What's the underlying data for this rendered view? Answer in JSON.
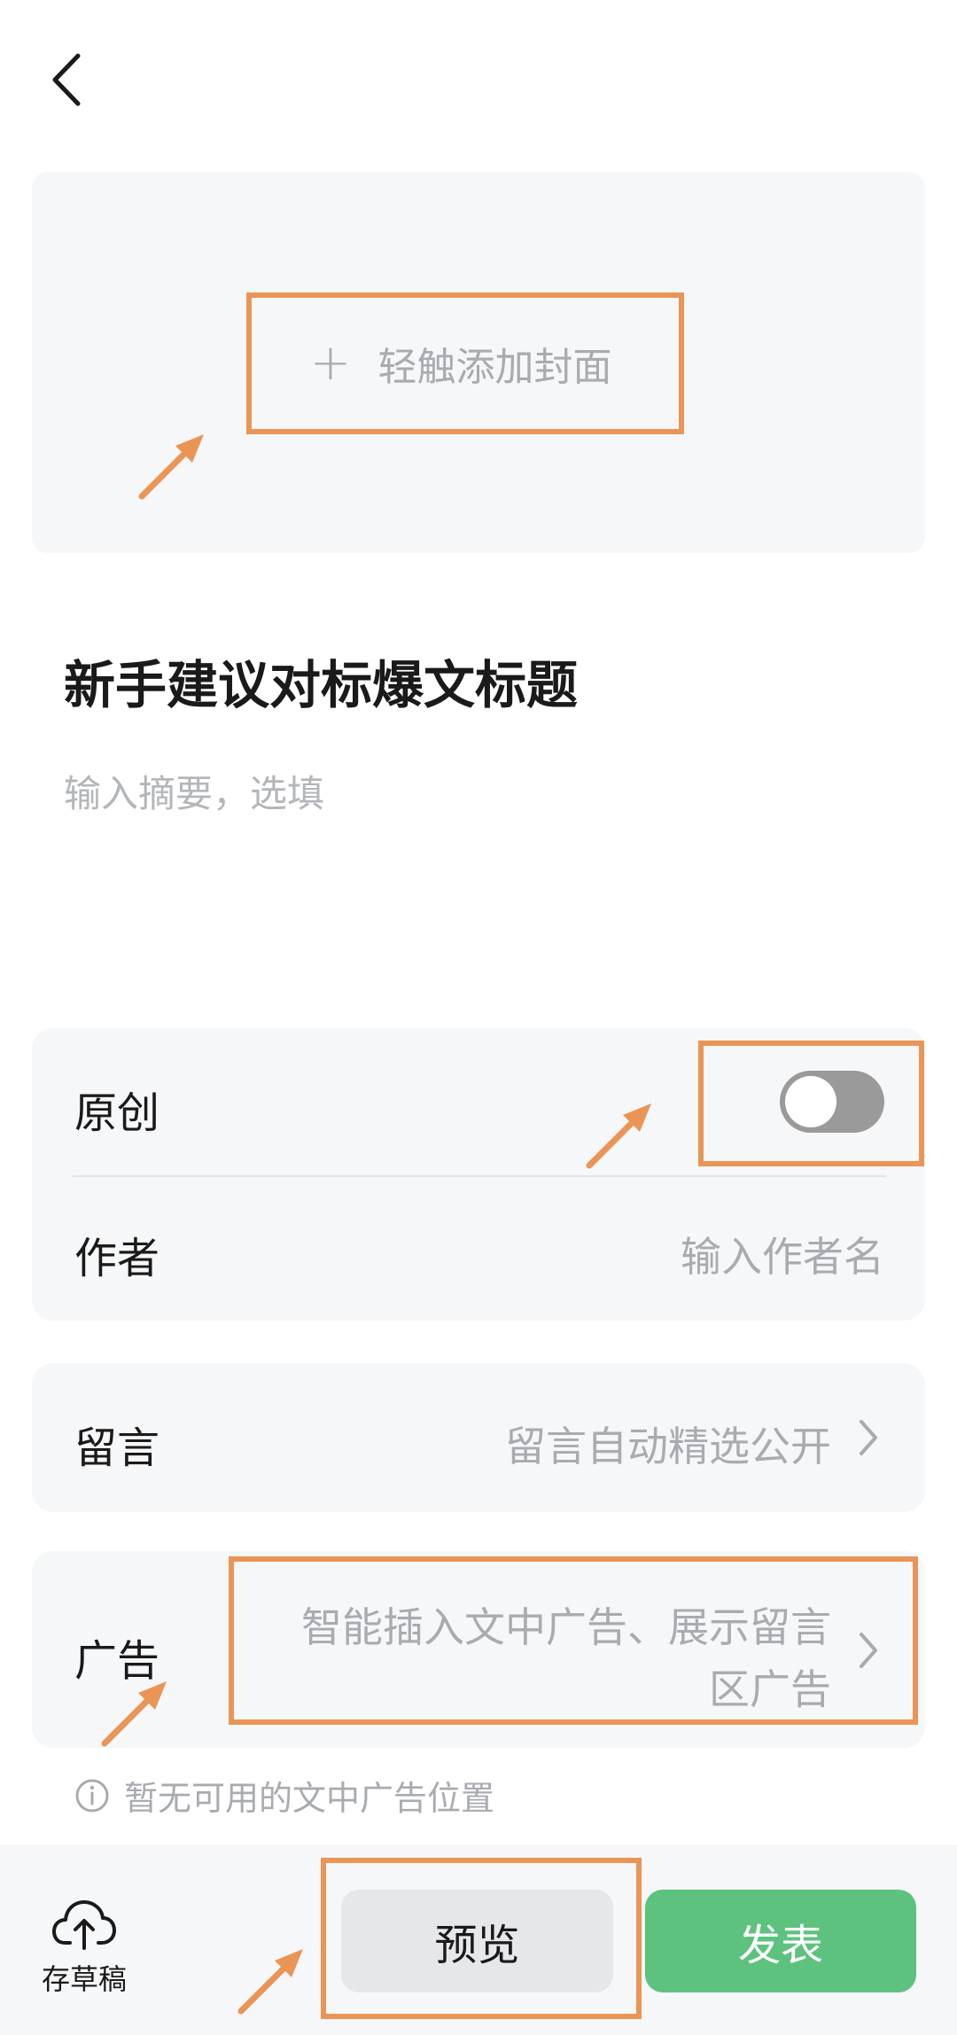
{
  "header": {
    "back_icon": "chevron-left-icon"
  },
  "cover": {
    "add_label": "轻触添加封面",
    "plus_icon": "plus-icon"
  },
  "article": {
    "title": "新手建议对标爆文标题",
    "summary_placeholder": "输入摘要，选填"
  },
  "settings": {
    "original": {
      "label": "原创",
      "enabled": false
    },
    "author": {
      "label": "作者",
      "placeholder": "输入作者名"
    },
    "comments": {
      "label": "留言",
      "value": "留言自动精选公开"
    },
    "ads": {
      "label": "广告",
      "value_line1": "智能插入文中广告、展示留言",
      "value_line2": "区广告"
    },
    "ads_hint": "暂无可用的文中广告位置"
  },
  "bottom_bar": {
    "draft_label": "存草稿",
    "draft_icon": "cloud-upload-icon",
    "preview_label": "预览",
    "publish_label": "发表"
  },
  "colors": {
    "accent_green": "#5ec27f",
    "highlight_orange": "#ea9556",
    "toggle_off": "#9a9a9a",
    "card_bg": "#f6f7f9"
  }
}
